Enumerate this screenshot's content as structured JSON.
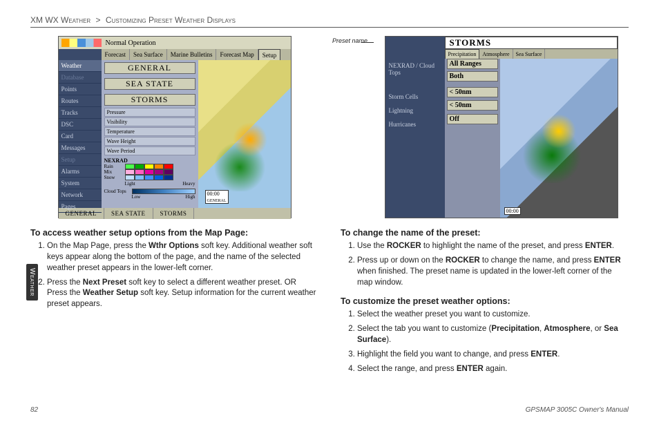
{
  "breadcrumb": {
    "section": "XM WX Weather",
    "sep": ">",
    "sub": "Customizing Preset Weather Displays"
  },
  "side_tab": "Weather",
  "left_shot": {
    "title": "Normal Operation",
    "top_tabs": [
      "Forecast",
      "Sea Surface",
      "Marine Bulletins",
      "Forecast Map",
      "Setup"
    ],
    "sidebar": [
      "Weather",
      "Database",
      "Points",
      "Routes",
      "Tracks",
      "DSC",
      "Card",
      "Messages",
      "Setup",
      "Alarms",
      "System",
      "Network",
      "Pages"
    ],
    "buttons": [
      "GENERAL",
      "SEA STATE",
      "STORMS"
    ],
    "subitems": [
      "Pressure",
      "Visibility",
      "Temperature",
      "Wave Height",
      "Wave Period"
    ],
    "nexrad_head": "NEXRAD",
    "nexrad_rows": [
      "Rain",
      "Mix",
      "Snow"
    ],
    "scale_labels": [
      "Light",
      "Heavy"
    ],
    "cloud_tops": "Cloud Tops",
    "cloud_scale": [
      "Low",
      "High"
    ],
    "clock": "00:00",
    "corner1": "GENERAL",
    "bottom_tabs": [
      "GENERAL",
      "SEA STATE",
      "STORMS"
    ]
  },
  "right_shot": {
    "preset_label": "Preset name",
    "header": "STORMS",
    "tabs": [
      "Precipitation",
      "Atmosphere",
      "Sea Surface"
    ],
    "rows": [
      {
        "label": "NEXRAD / Cloud Tops",
        "value": "All Ranges"
      },
      {
        "label": "",
        "value": "Both"
      },
      {
        "label": "Storm Cells",
        "value": "< 50nm"
      },
      {
        "label": "Lightning",
        "value": "< 50nm"
      },
      {
        "label": "Hurricanes",
        "value": "Off"
      }
    ],
    "clock": "00:00"
  },
  "left_col": {
    "h1": "To access weather setup options from the Map Page:",
    "l1a": "On the Map Page, press the ",
    "l1b": "Wthr Options",
    "l1c": " soft key. Additional weather soft keys appear along the bottom of the page, and the name of the selected weather preset appears in the lower-left corner.",
    "l2a": "Press the ",
    "l2b": "Next Preset",
    "l2c": " soft key to select a different weather preset. OR",
    "l2d": "Press the ",
    "l2e": "Weather Setup",
    "l2f": " soft key. Setup information for the current weather preset appears."
  },
  "right_col": {
    "h1": "To change the name of the preset:",
    "r1a": "Use the ",
    "r1b": "ROCKER",
    "r1c": " to highlight the name of the preset, and press ",
    "r1d": "ENTER",
    "r1e": ".",
    "r2a": "Press up or down on the ",
    "r2b": "ROCKER",
    "r2c": " to change the name, and press ",
    "r2d": "ENTER",
    "r2e": " when finished. The preset name is updated in the lower-left corner of the map window.",
    "h2": "To customize the preset weather options:",
    "c1": "Select the weather preset you want to customize.",
    "c2a": "Select the tab you want to customize (",
    "c2b": "Precipitation",
    "c2c": ", ",
    "c2d": "Atmosphere",
    "c2e": ", or ",
    "c2f": "Sea Surface",
    "c2g": ").",
    "c3a": "Highlight the field you want to change, and press ",
    "c3b": "ENTER",
    "c3c": ".",
    "c4a": "Select the range, and press ",
    "c4b": "ENTER",
    "c4c": " again."
  },
  "footer": {
    "page": "82",
    "manual": "GPSMAP 3005C Owner's Manual"
  }
}
